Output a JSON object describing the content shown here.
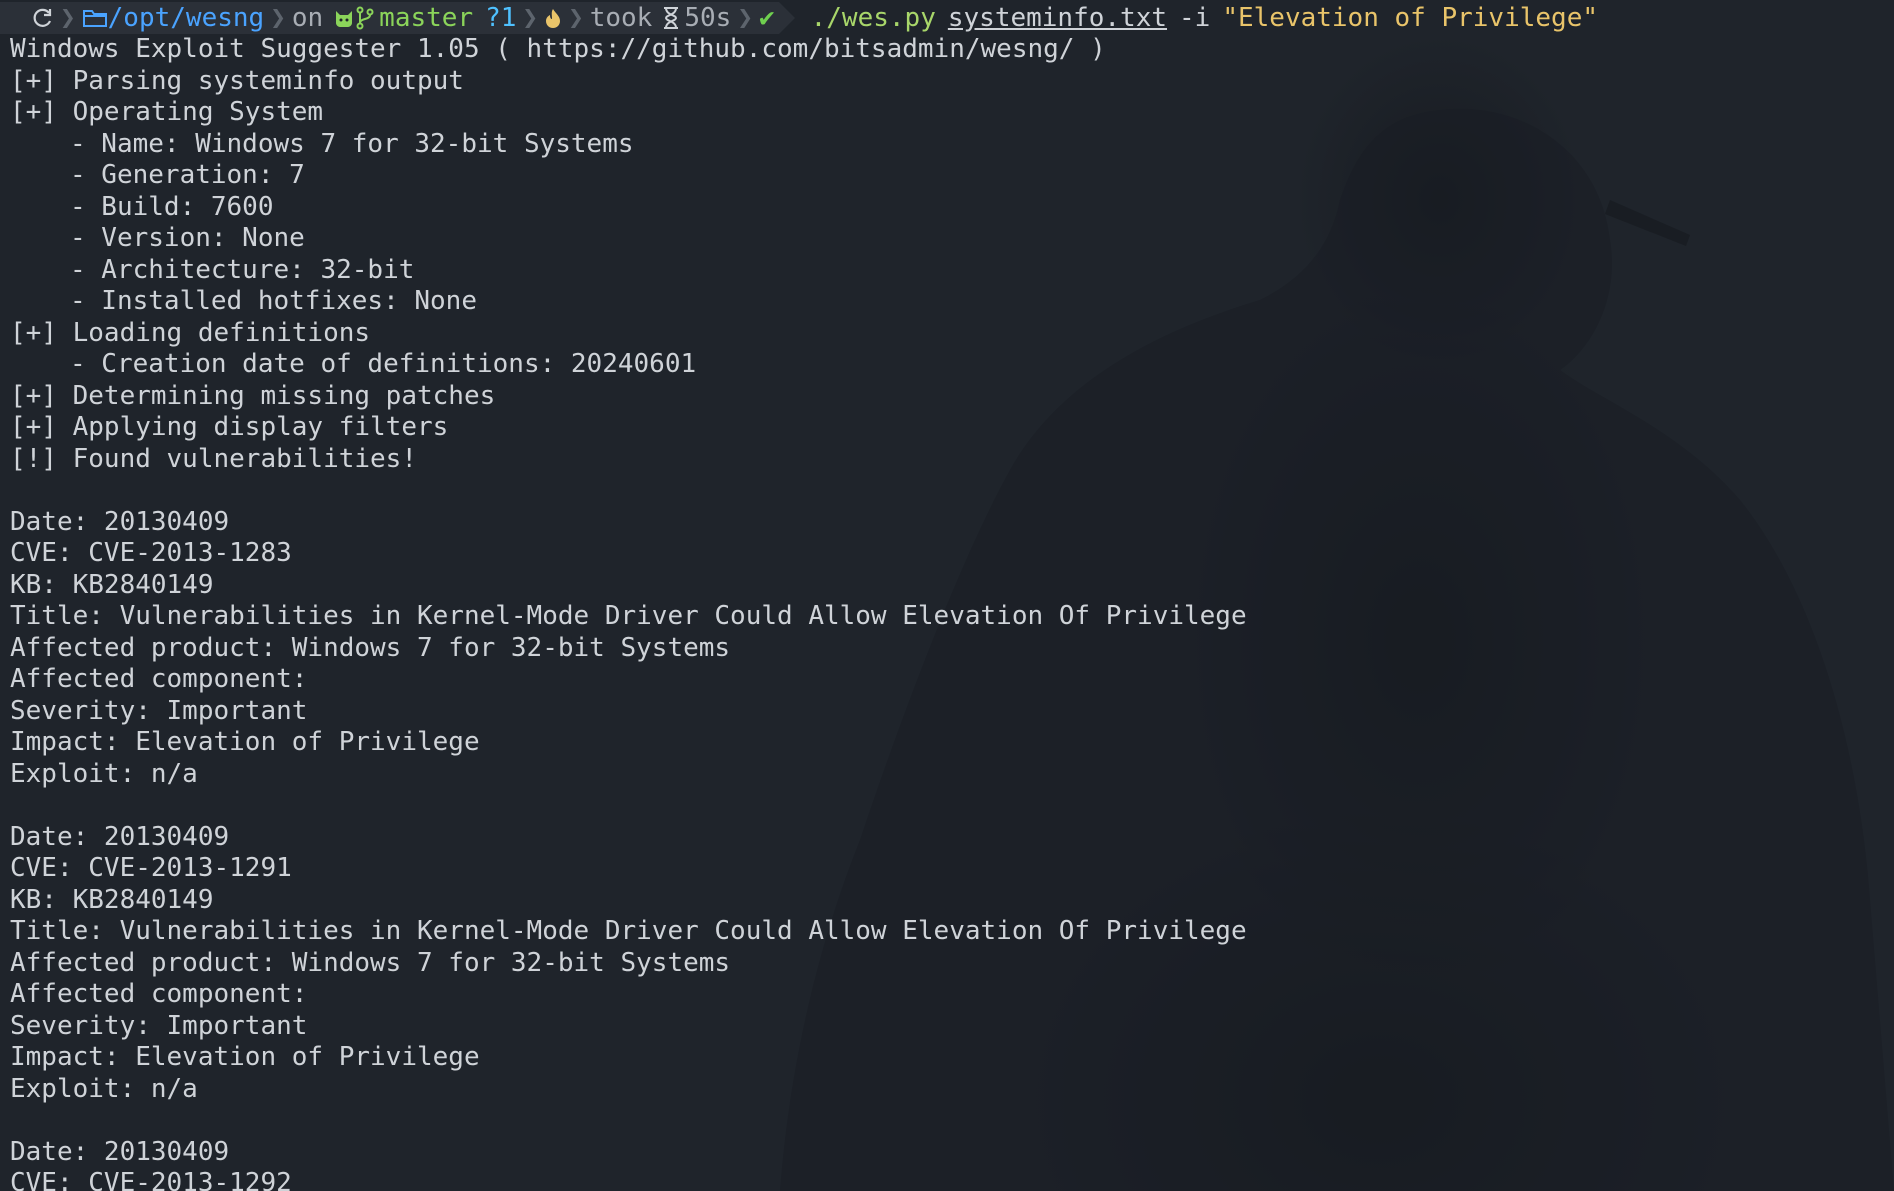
{
  "prompt": {
    "path": "/opt/wesng",
    "on": "on",
    "branch": "master",
    "git_status": "?1",
    "took": "took",
    "duration": "50s",
    "command_exe": "./wes.py",
    "command_file": "systeminfo.txt",
    "command_flag": "-i",
    "command_arg": "\"Elevation of Privilege\"",
    "icons": [
      "refresh-icon",
      "folder-icon",
      "github-cat-icon",
      "git-branch-icon",
      "fire-icon",
      "hourglass-icon",
      "check-icon"
    ],
    "colors": {
      "path": "#4aa3ff",
      "branch": "#8bd45a",
      "status": "#4fc1ff",
      "arg": "#e9c46a",
      "check": "#6fcf4f"
    }
  },
  "output": {
    "banner": "Windows Exploit Suggester 1.05 ( https://github.com/bitsadmin/wesng/ )",
    "parsing": "[+] Parsing systeminfo output",
    "os_header": "[+] Operating System",
    "os_details": [
      "- Name: Windows 7 for 32-bit Systems",
      "- Generation: 7",
      "- Build: 7600",
      "- Version: None",
      "- Architecture: 32-bit",
      "- Installed hotfixes: None"
    ],
    "loading": "[+] Loading definitions",
    "creation_date": "- Creation date of definitions: 20240601",
    "determining": "[+] Determining missing patches",
    "applying": "[+] Applying display filters",
    "found": "[!] Found vulnerabilities!"
  },
  "vulnerabilities": [
    {
      "date": "Date: 20130409",
      "cve": "CVE: CVE-2013-1283",
      "kb": "KB: KB2840149",
      "title": "Title: Vulnerabilities in Kernel-Mode Driver Could Allow Elevation Of Privilege",
      "product": "Affected product: Windows 7 for 32-bit Systems",
      "component": "Affected component:",
      "severity": "Severity: Important",
      "impact": "Impact: Elevation of Privilege",
      "exploit": "Exploit: n/a"
    },
    {
      "date": "Date: 20130409",
      "cve": "CVE: CVE-2013-1291",
      "kb": "KB: KB2840149",
      "title": "Title: Vulnerabilities in Kernel-Mode Driver Could Allow Elevation Of Privilege",
      "product": "Affected product: Windows 7 for 32-bit Systems",
      "component": "Affected component:",
      "severity": "Severity: Important",
      "impact": "Impact: Elevation of Privilege",
      "exploit": "Exploit: n/a"
    },
    {
      "date": "Date: 20130409",
      "cve": "CVE: CVE-2013-1292"
    }
  ]
}
